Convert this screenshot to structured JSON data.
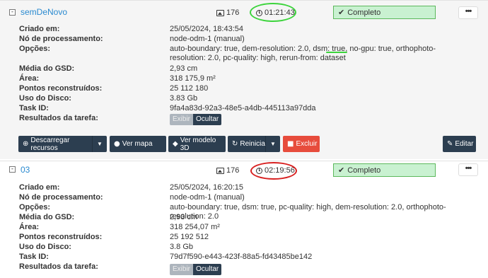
{
  "tasks": [
    {
      "name": "semDeNovo",
      "toggle": "-",
      "images": "176",
      "elapsed": "01:21:43",
      "status": "Completo",
      "more": "•••",
      "rows": [
        {
          "label": "Criado em:",
          "value": "25/05/2024, 18:43:54"
        },
        {
          "label": "Nó de processamento:",
          "value": "node-odm-1 (manual)"
        },
        {
          "label": "Opções:",
          "value": "auto-boundary: true, dem-resolution: 2.0, dsm: true, no-gpu: true, orthophoto-resolution: 2.0, pc-quality: high, rerun-from: dataset"
        },
        {
          "label": "Média do GSD:",
          "value": "2,93 cm"
        },
        {
          "label": "Área:",
          "value": "318 175,9 m²"
        },
        {
          "label": "Pontos reconstruídos:",
          "value": "25 112 180"
        },
        {
          "label": "Uso do Disco:",
          "value": "3.83 Gb"
        },
        {
          "label": "Task ID:",
          "value": "9fa4a83d-92a3-48e5-a4db-445113a97dda"
        },
        {
          "label": "Resultados da tarefa:",
          "value": ""
        }
      ],
      "results_toggle": {
        "show": "Exibir",
        "hide": "Ocultar"
      },
      "actions": {
        "download": "Descarregar recursos",
        "map": "Ver mapa",
        "model3d": "Ver modelo 3D",
        "restart": "Reiniciar",
        "delete": "Excluir",
        "edit": "Editar"
      }
    },
    {
      "name": "03",
      "toggle": "-",
      "images": "176",
      "elapsed": "02:19:56",
      "status": "Completo",
      "more": "•••",
      "rows": [
        {
          "label": "Criado em:",
          "value": "25/05/2024, 16:20:15"
        },
        {
          "label": "Nó de processamento:",
          "value": "node-odm-1 (manual)"
        },
        {
          "label": "Opções:",
          "value": "auto-boundary: true, dsm: true, pc-quality: high, dem-resolution: 2.0, orthophoto-resolution: 2.0"
        },
        {
          "label": "Média do GSD:",
          "value": "2,93 cm"
        },
        {
          "label": "Área:",
          "value": "318 254,07 m²"
        },
        {
          "label": "Pontos reconstruídos:",
          "value": "25 192 512"
        },
        {
          "label": "Uso do Disco:",
          "value": "3.8 Gb"
        },
        {
          "label": "Task ID:",
          "value": "79d7f590-e443-423f-88a5-fd43485be142"
        },
        {
          "label": "Resultados da tarefa:",
          "value": ""
        }
      ],
      "results_toggle": {
        "show": "Exibir",
        "hide": "Ocultar"
      }
    }
  ],
  "colors": {
    "link": "#2a8ad0",
    "status_bg": "#c9f1d1",
    "status_border": "#5cb85c",
    "dark_button": "#2c3e50",
    "danger_button": "#e74c3c",
    "annotation_green": "#3cd43c",
    "annotation_red": "#d82020"
  }
}
